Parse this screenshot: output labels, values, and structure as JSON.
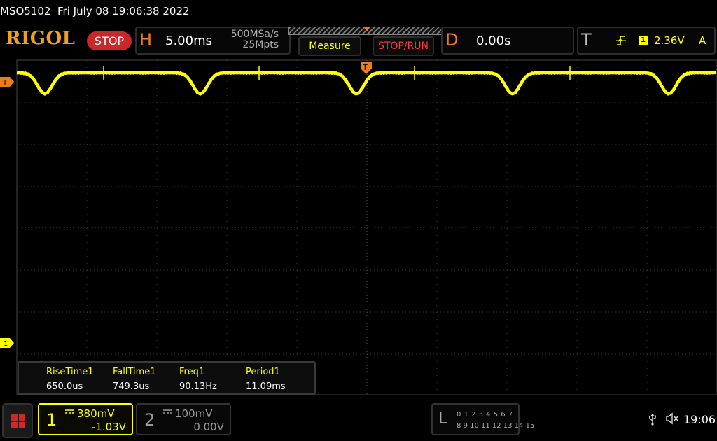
{
  "status": {
    "model": "MSO5102",
    "datetime": "Fri July 08 19:06:38 2022"
  },
  "brand": {
    "logo": "RIGOL",
    "run_state": "STOP"
  },
  "horizontal": {
    "letter": "H",
    "timebase": "5.00ms",
    "sample_rate": "500MSa/s",
    "memory_depth": "25Mpts"
  },
  "buttons": {
    "measure": "Measure",
    "stop_run": "STOP/RUN"
  },
  "delay": {
    "letter": "D",
    "value": "0.00s"
  },
  "trigger": {
    "letter": "T",
    "edge_icon": "rising-edge-icon",
    "source": "1",
    "level": "2.36V",
    "mode": "A",
    "marker": "T"
  },
  "markers": {
    "ch1_ground": "1",
    "trigger_level": "T"
  },
  "measurements": [
    {
      "name": "RiseTime1",
      "value": "650.0us"
    },
    {
      "name": "FallTime1",
      "value": "749.3us"
    },
    {
      "name": "Freq1",
      "value": "90.13Hz"
    },
    {
      "name": "Period1",
      "value": "11.09ms"
    }
  ],
  "channels": {
    "ch1": {
      "num": "1",
      "coupling_icon": "dc-coupling-icon",
      "scale": "380mV",
      "offset": "-1.03V",
      "color": "#ffff00"
    },
    "ch2": {
      "num": "2",
      "coupling_icon": "dc-coupling-icon",
      "scale": "100mV",
      "offset": "0.00V",
      "color": "#9a9a9a"
    }
  },
  "logic": {
    "letter": "L",
    "row1": "0 1 2 3  4 5 6 7",
    "row2": "8 9 10 11 12 13 14 15"
  },
  "system": {
    "usb_icon": "usb-icon",
    "sound_icon": "speaker-muted-icon",
    "time": "19:06"
  },
  "colors": {
    "trace": "#ffff00",
    "accent": "#f07c18",
    "stop": "#c8282a",
    "grid": "#3c3c3c"
  }
}
